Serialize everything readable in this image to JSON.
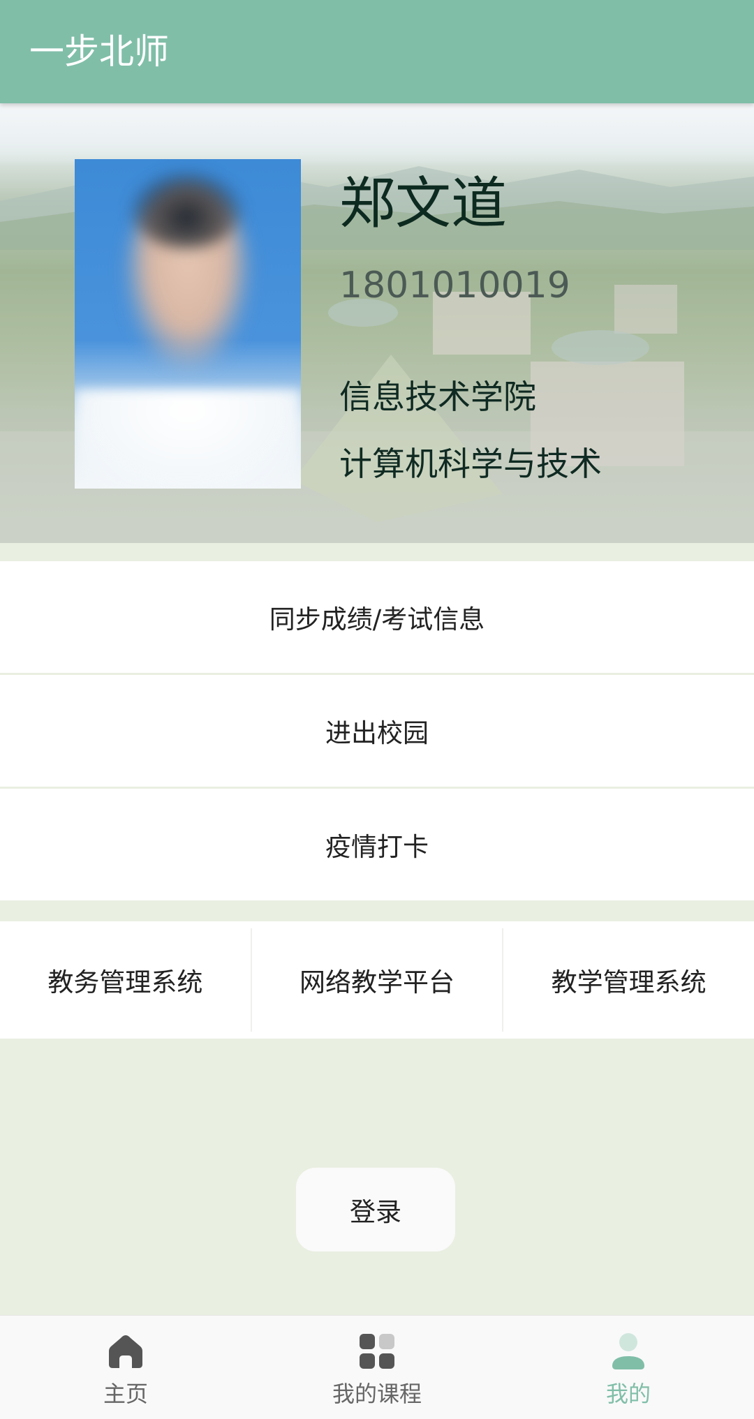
{
  "app": {
    "title": "一步北师"
  },
  "profile": {
    "name": "郑文道",
    "student_id": "1801010019",
    "college": "信息技术学院",
    "major": "计算机科学与技术"
  },
  "menu": [
    {
      "label": "同步成绩/考试信息"
    },
    {
      "label": "进出校园"
    },
    {
      "label": "疫情打卡"
    }
  ],
  "links": [
    {
      "label": "教务管理系统"
    },
    {
      "label": "网络教学平台"
    },
    {
      "label": "教学管理系统"
    }
  ],
  "login": {
    "label": "登录"
  },
  "tabs": [
    {
      "label": "主页",
      "icon": "home-icon"
    },
    {
      "label": "我的课程",
      "icon": "grid-icon"
    },
    {
      "label": "我的",
      "icon": "user-icon",
      "active": true
    }
  ],
  "colors": {
    "accent": "#80bea8",
    "background": "#e9efe1",
    "text": "#222222"
  }
}
